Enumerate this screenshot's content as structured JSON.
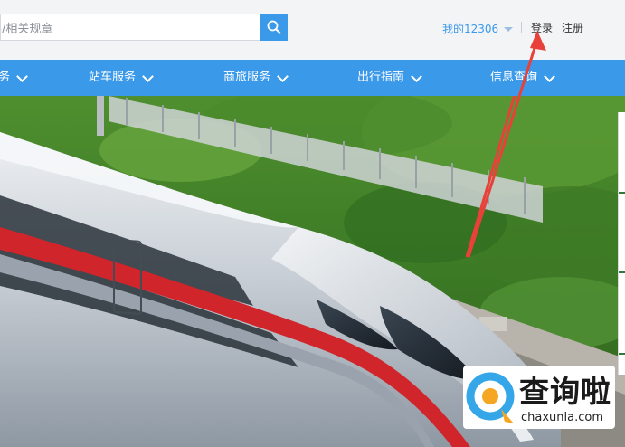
{
  "search": {
    "placeholder": "搜索车票、 餐饮、 常旅客/相关规章",
    "value": "客/相关规章"
  },
  "user_menu": {
    "my_label": "我的12306",
    "login_label": "登录",
    "register_label": "注册"
  },
  "nav": {
    "items": [
      {
        "label": "务"
      },
      {
        "label": "站车服务"
      },
      {
        "label": "商旅服务"
      },
      {
        "label": "出行指南"
      },
      {
        "label": "信息查询"
      }
    ]
  },
  "watermark": {
    "brand": "查询啦",
    "url": "chaxunla.com"
  },
  "colors": {
    "accent": "#3b99e9",
    "arrow": "#e8413a"
  }
}
